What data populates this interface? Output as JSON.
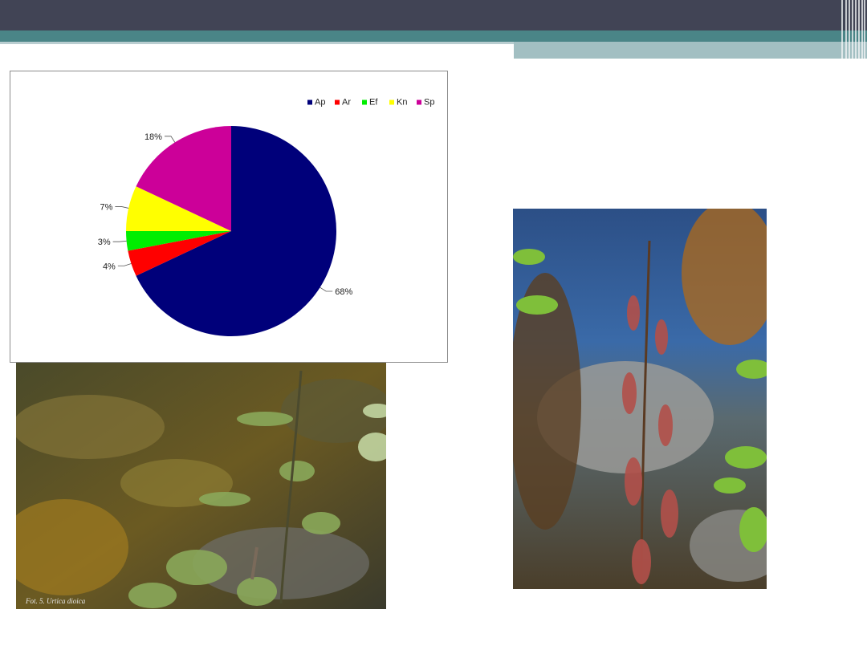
{
  "colors": {
    "header_dark": "#414455",
    "header_teal": "#4a8587",
    "header_light": "#a2bfc2"
  },
  "chart_data": {
    "type": "pie",
    "categories": [
      "Ap",
      "Ar",
      "Ef",
      "Kn",
      "Sp"
    ],
    "values": [
      68,
      4,
      3,
      7,
      18
    ],
    "labels": [
      "68%",
      "4%",
      "3%",
      "7%",
      "18%"
    ],
    "colors": [
      "#00007a",
      "#ff0000",
      "#00ee00",
      "#ffff00",
      "#cc0099"
    ],
    "legend_position": "top-right",
    "start": "12 o'clock, clockwise"
  },
  "photos": [
    {
      "name": "nettle-photo",
      "caption": "Fot. 5. Urtica dioica"
    },
    {
      "name": "stream-plant-photo",
      "caption": ""
    }
  ]
}
